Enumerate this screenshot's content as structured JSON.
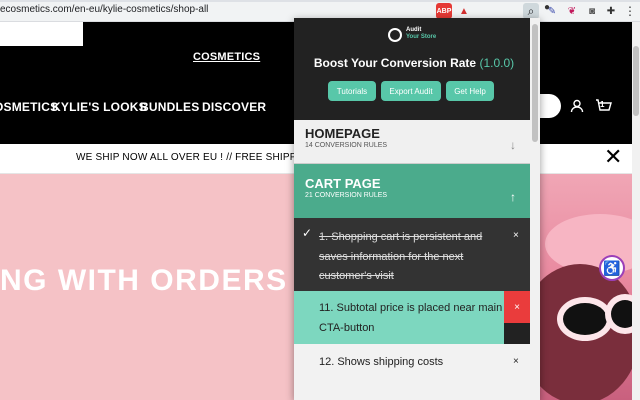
{
  "browser": {
    "url": "ecosmetics.com/en-eu/kylie-cosmetics/shop-all",
    "extensions": [
      "abp-icon",
      "adobe-icon",
      "search-icon",
      "pen-icon",
      "feather-icon",
      "camera-icon",
      "puzzle-icon",
      "menu-icon"
    ],
    "extension_glyphs": {
      "search": "⌕",
      "pen": "✎",
      "feather": "❦",
      "camera": "◙",
      "puzzle": "✚",
      "menu": "⋮",
      "warn": "▲",
      "circle": "●"
    }
  },
  "site": {
    "brand_link": "COSMETICS",
    "nav": [
      "OSMETICS",
      "KYLIE'S LOOKS",
      "BUNDLES",
      "DISCOVER"
    ],
    "cart_count": "1",
    "shipping_banner": "WE SHIP NOW ALL OVER EU ! // FREE SHIPPING WITH",
    "close_glyph": "✕",
    "hero_text": "NG WITH ORDERS",
    "accessibility_glyph": "♿"
  },
  "popup": {
    "logo_line1": "Audit",
    "logo_line2": "Your Store",
    "title": "Boost Your Conversion Rate",
    "version": "(1.0.0)",
    "buttons": [
      "Tutorials",
      "Export Audit",
      "Get Help"
    ],
    "sections": {
      "homepage": {
        "title": "HOMEPAGE",
        "rules": "14 CONVERSION RULES",
        "arrow": "↓"
      },
      "cart": {
        "title": "CART PAGE",
        "rules": "21 CONVERSION RULES",
        "arrow": "↑"
      }
    },
    "rules": [
      {
        "text": "1. Shopping cart is persistent and saves information for the next customer's visit",
        "done": true,
        "check": "✓",
        "close": "×"
      },
      {
        "text": "11. Subtotal price is placed near main CTA-button",
        "highlighted": true,
        "close": "×"
      },
      {
        "text": "12. Shows shipping costs",
        "close": "×"
      }
    ]
  },
  "colors": {
    "accent": "#58c7a9",
    "cart_header": "#4bab8c",
    "delete": "#ea3c3c",
    "hero": "#f5c2c6"
  }
}
